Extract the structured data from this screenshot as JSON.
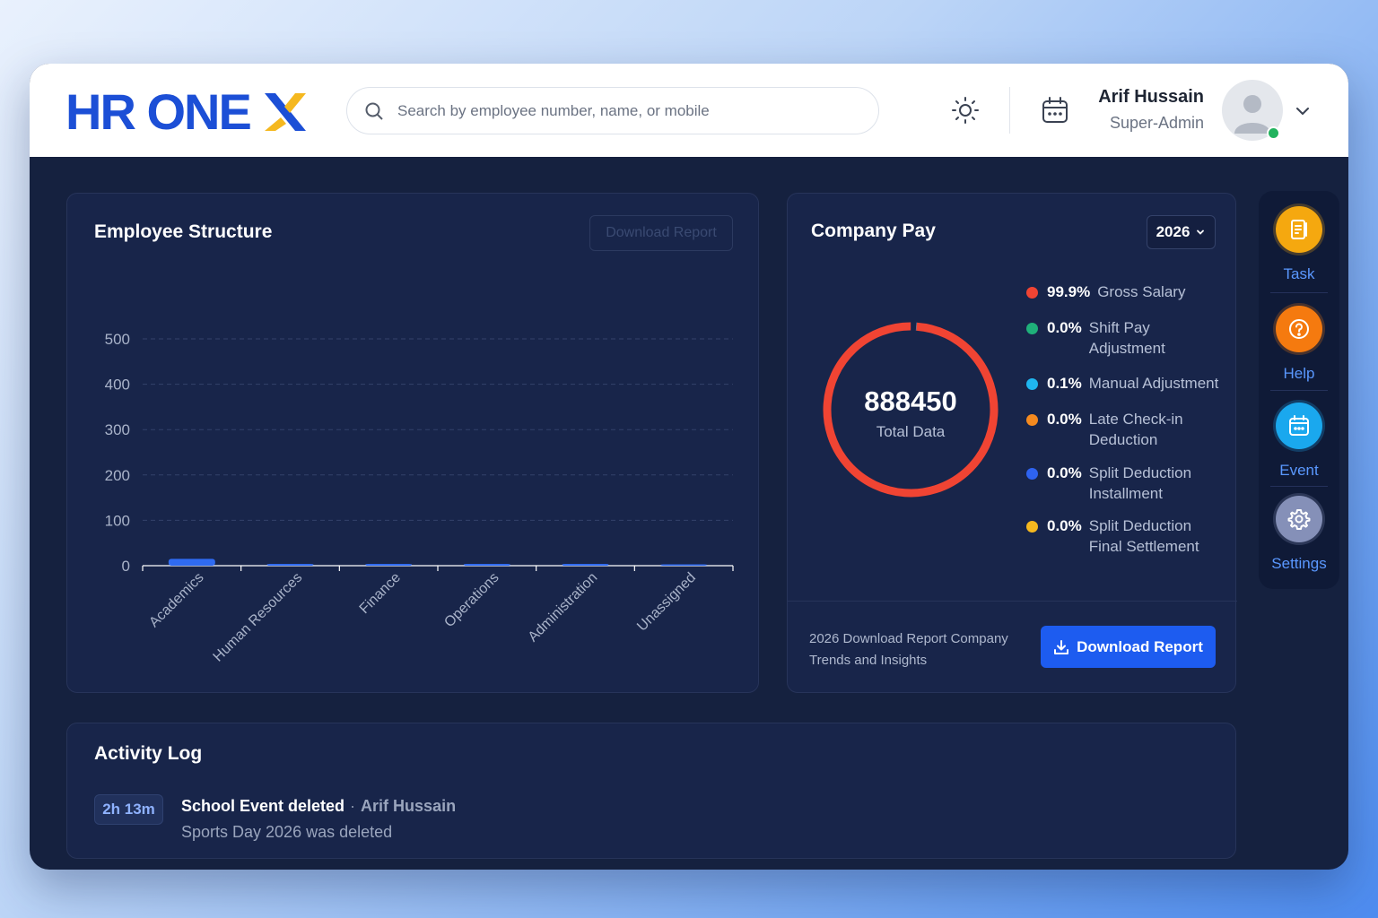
{
  "header": {
    "logo_text": "HR ONE",
    "search_placeholder": "Search by employee number, name, or mobile",
    "user_name": "Arif Hussain",
    "user_role": "Super-Admin"
  },
  "employee_structure": {
    "title": "Employee Structure",
    "download_label": "Download Report"
  },
  "company_pay": {
    "title": "Company Pay",
    "year": "2026",
    "total_value": "888450",
    "total_label": "Total Data",
    "legend": [
      {
        "pct": "99.9%",
        "name": "Gross Salary",
        "color": "#f04433"
      },
      {
        "pct": "0.0%",
        "name": "Shift Pay Adjustment",
        "color": "#1fb07a"
      },
      {
        "pct": "0.1%",
        "name": "Manual Adjustment",
        "color": "#1fb6f0"
      },
      {
        "pct": "0.0%",
        "name": "Late Check-in Deduction",
        "color": "#f58a1f"
      },
      {
        "pct": "0.0%",
        "name": "Split Deduction Installment",
        "color": "#2e63f0"
      },
      {
        "pct": "0.0%",
        "name": "Split Deduction Final Settlement",
        "color": "#f5b81f"
      }
    ],
    "footer_text": "2026 Download Report Company Trends and Insights",
    "download_label": "Download Report"
  },
  "rail": {
    "items": [
      {
        "label": "Task",
        "icon": "task-icon",
        "color": "#f5a80f"
      },
      {
        "label": "Help",
        "icon": "help-icon",
        "color": "#f57a0f"
      },
      {
        "label": "Event",
        "icon": "event-icon",
        "color": "#1aa8ee"
      },
      {
        "label": "Settings",
        "icon": "gear-icon",
        "color": "#8590b8"
      }
    ]
  },
  "activity_log": {
    "title": "Activity Log",
    "entries": [
      {
        "time": "2h 13m",
        "title": "School Event deleted",
        "user": "Arif Hussain",
        "description": "Sports Day 2026 was deleted"
      }
    ]
  },
  "chart_data": [
    {
      "type": "bar",
      "categories": [
        "Academics",
        "Human Resources",
        "Finance",
        "Operations",
        "Administration",
        "Unassigned"
      ],
      "values": [
        15,
        1,
        1,
        1,
        1,
        0
      ],
      "ylim": [
        0,
        500
      ],
      "yticks": [
        0,
        100,
        200,
        300,
        400,
        500
      ],
      "grid": true,
      "bar_color": "#2f6bf2"
    },
    {
      "type": "pie",
      "categories": [
        "Gross Salary",
        "Shift Pay Adjustment",
        "Manual Adjustment",
        "Late Check-in Deduction",
        "Split Deduction Installment",
        "Split Deduction Final Settlement"
      ],
      "values": [
        99.9,
        0.0,
        0.1,
        0.0,
        0.0,
        0.0
      ]
    }
  ]
}
